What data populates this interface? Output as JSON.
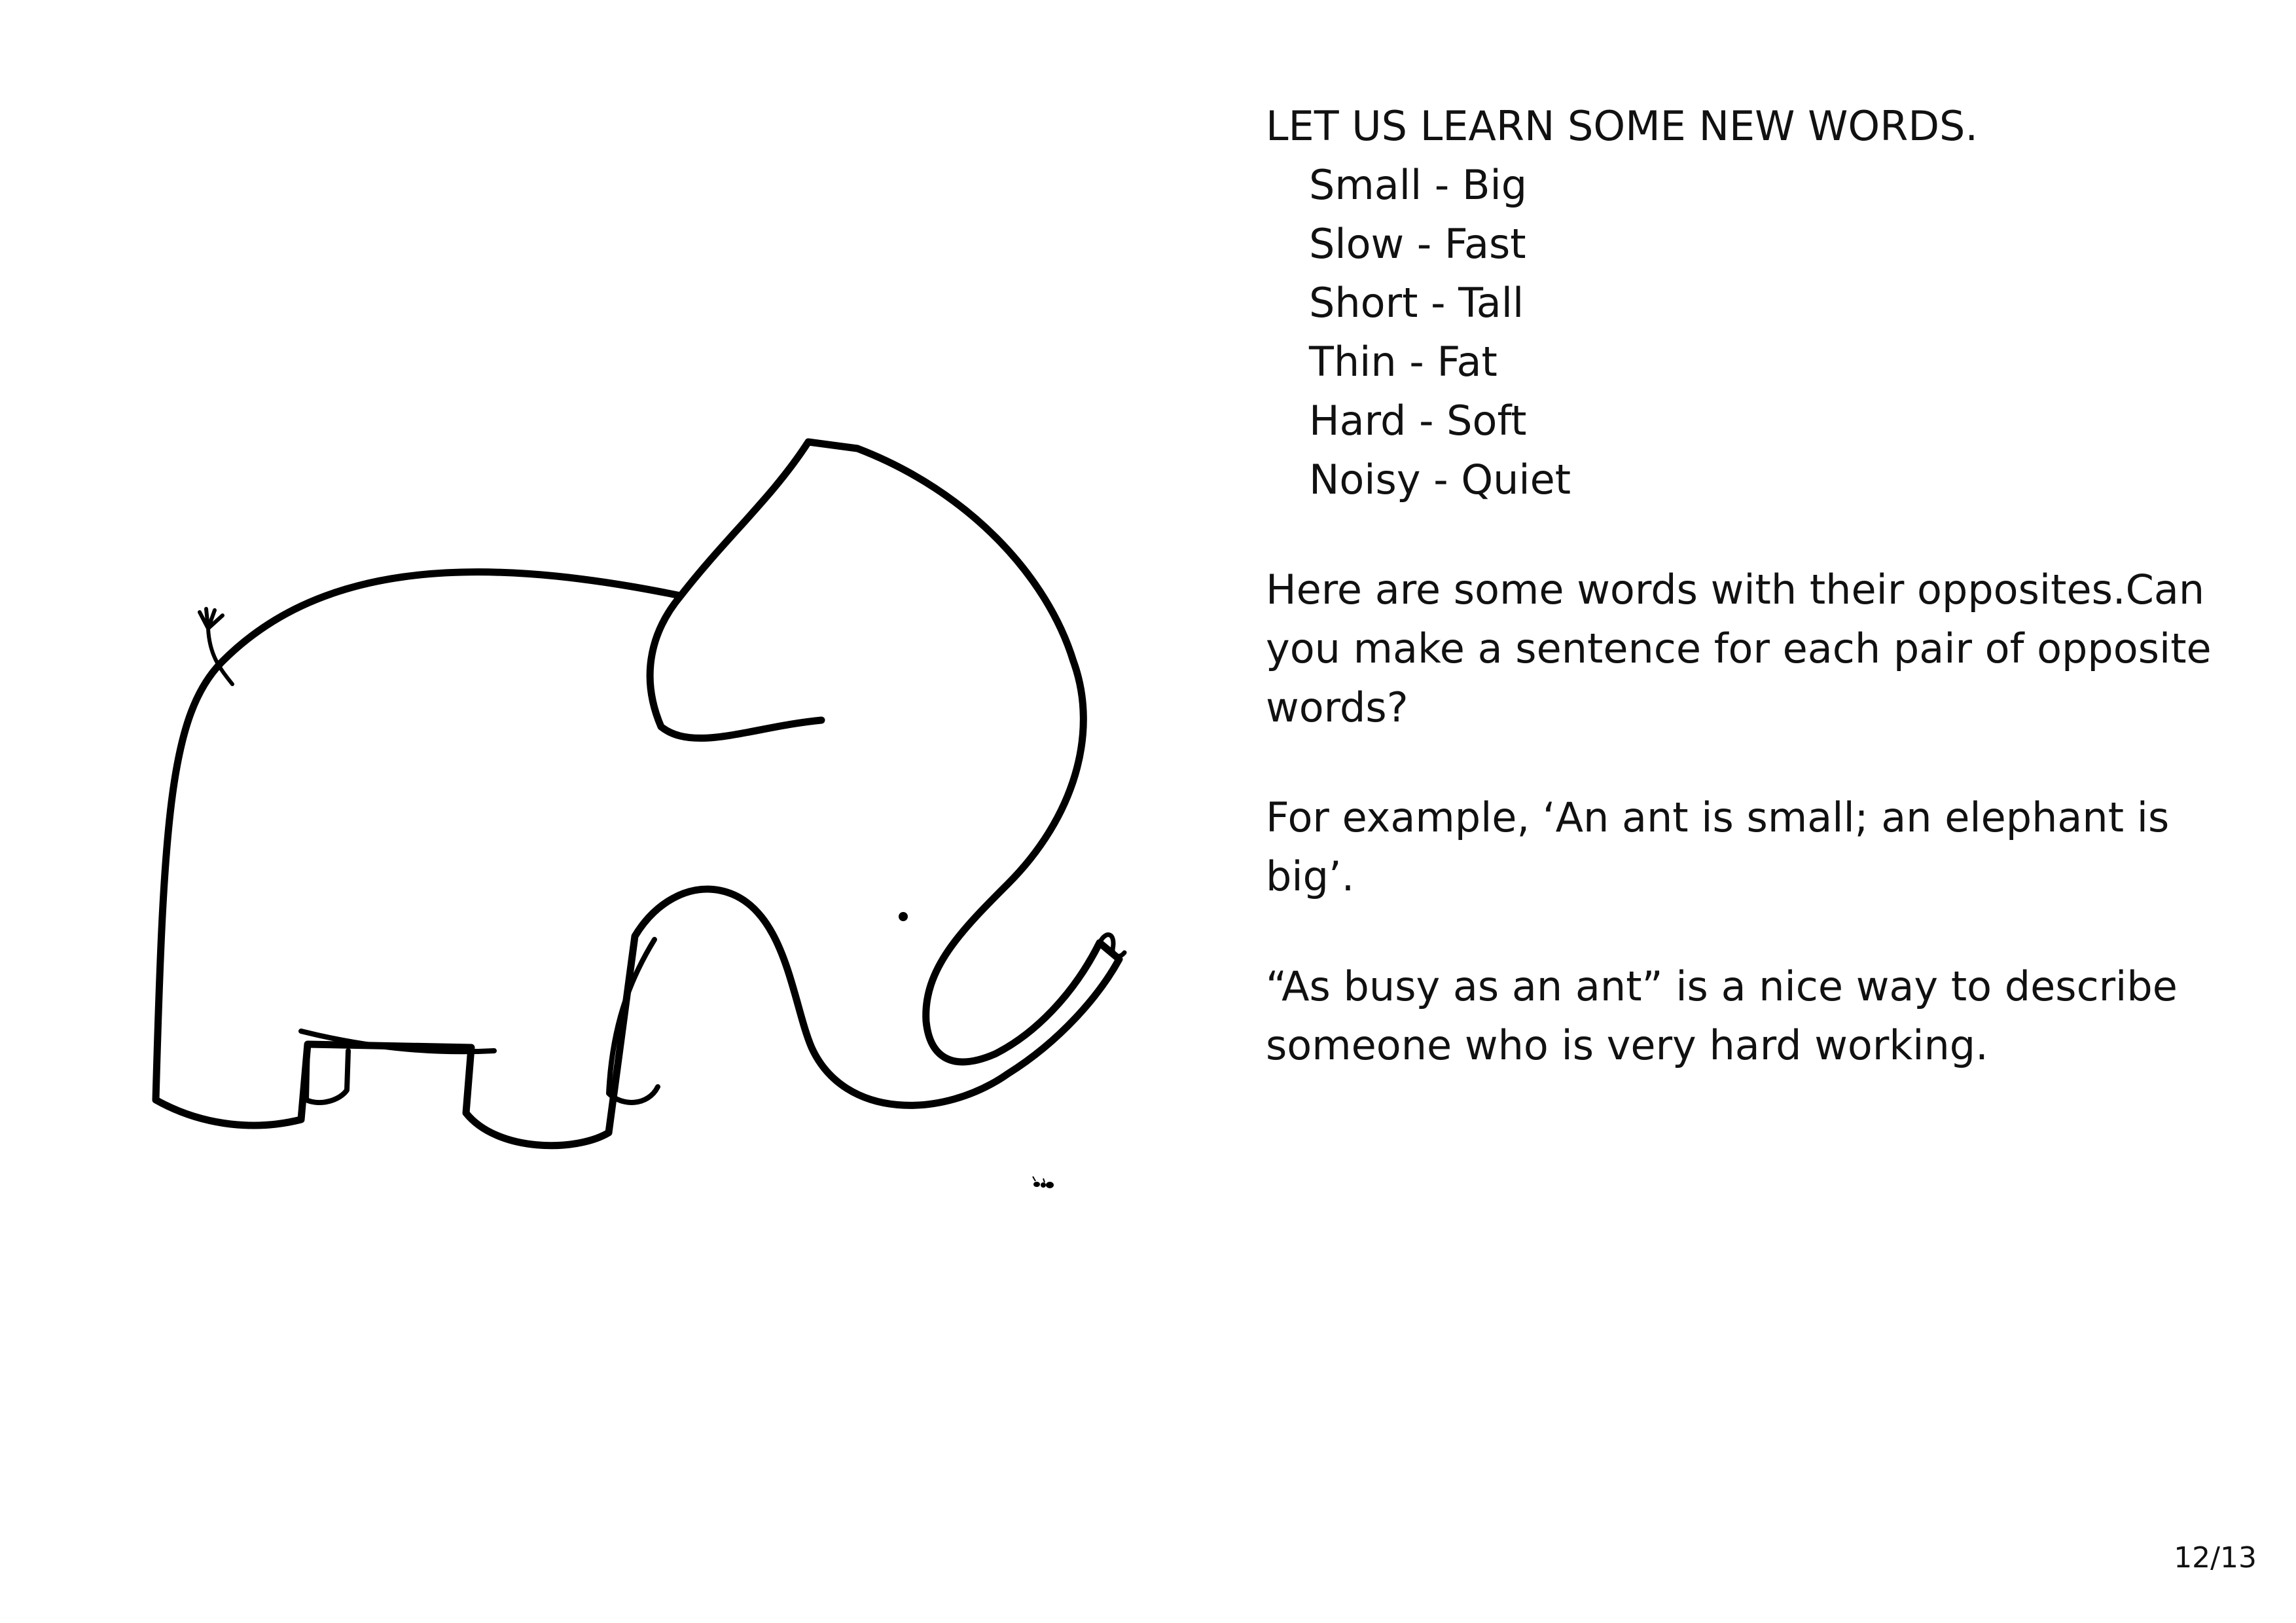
{
  "heading": "LET US LEARN SOME NEW WORDS.",
  "word_pairs": [
    "Small - Big",
    "Slow - Fast",
    "Short - Tall",
    "Thin - Fat",
    "Hard - Soft",
    "Noisy - Quiet"
  ],
  "paragraphs": [
    "Here are some words with their opposites.Can you make a sentence for each pair of opposite words?",
    "For example, ‘An ant is small; an elephant is big’.",
    "“As busy as an ant” is a nice way to describe someone who is very hard working."
  ],
  "page_number": "12/13",
  "illustration": {
    "subject": "elephant-outline-with-ant",
    "stroke_color": "#000000"
  }
}
